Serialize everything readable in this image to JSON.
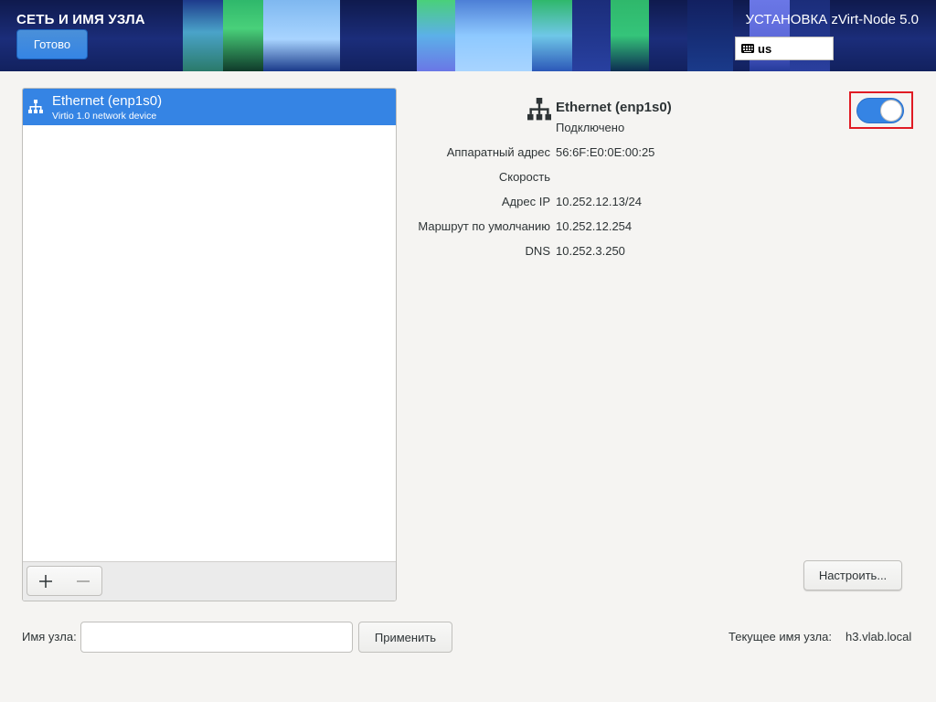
{
  "header": {
    "section_title": "СЕТЬ И ИМЯ УЗЛА",
    "done_label": "Готово",
    "install_title": "УСТАНОВКА zVirt-Node 5.0",
    "keyboard_layout": "us"
  },
  "devices": [
    {
      "name": "Ethernet (enp1s0)",
      "description": "Virtio 1.0 network device",
      "icon": "network-wired-icon",
      "selected": true
    }
  ],
  "details": {
    "name": "Ethernet (enp1s0)",
    "status": "Подключено",
    "enabled": true,
    "properties": [
      {
        "label": "Аппаратный адрес",
        "value": "56:6F:E0:0E:00:25"
      },
      {
        "label": "Скорость",
        "value": ""
      },
      {
        "label": "Адрес IP",
        "value": "10.252.12.13/24"
      },
      {
        "label": "Маршрут по умолчанию",
        "value": "10.252.12.254"
      },
      {
        "label": "DNS",
        "value": "10.252.3.250"
      }
    ],
    "configure_label": "Настроить..."
  },
  "hostname": {
    "label": "Имя узла:",
    "value": "",
    "placeholder": "",
    "apply_label": "Применить",
    "current_label": "Текущее имя узла:",
    "current_value": "h3.vlab.local"
  },
  "colors": {
    "accent": "#3584e4",
    "highlight_frame": "#e01b24",
    "header_bg": "#1b2d7a"
  }
}
